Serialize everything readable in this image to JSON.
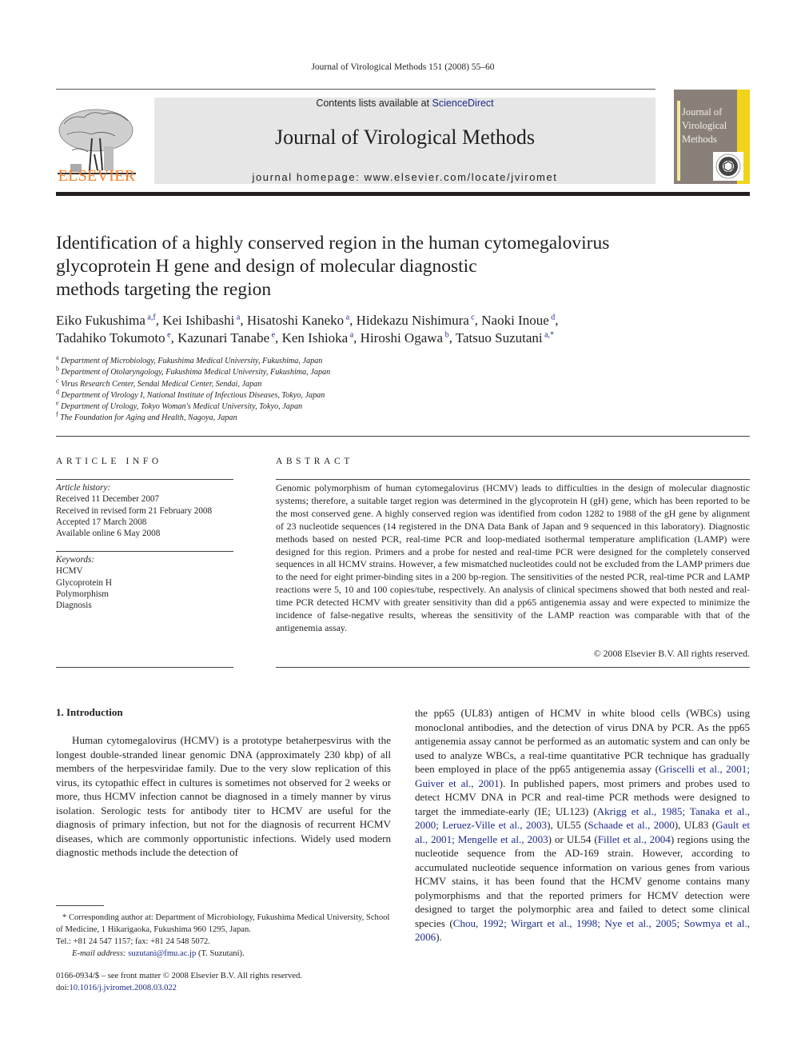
{
  "header": {
    "running_head": "Journal of Virological Methods 151 (2008) 55–60",
    "contents_prefix": "Contents lists available at ",
    "contents_link": "ScienceDirect",
    "journal_title": "Journal of Virological Methods",
    "homepage": "journal homepage: www.elsevier.com/locate/jviromet",
    "publisher_logo_text": "ELSEVIER",
    "cover_title": [
      "Journal of",
      "Virological",
      "Methods"
    ],
    "colors": {
      "elsevier_orange": "#f57b20",
      "link_blue": "#1b2a8a",
      "masthead_gray": "#e6e6e6",
      "cover_yellow": "#f2d31b"
    }
  },
  "article": {
    "title": "Identification of a highly conserved region in the human cytomegalovirus glycoprotein H gene and design of molecular diagnostic methods targeting the region",
    "title_lines": [
      "Identification of a highly conserved region in the human cytomegalovirus",
      "glycoprotein H gene and design of molecular diagnostic",
      "methods targeting the region"
    ],
    "authors": [
      {
        "name": "Eiko Fukushima",
        "aff": "a,f"
      },
      {
        "name": "Kei Ishibashi",
        "aff": "a"
      },
      {
        "name": "Hisatoshi Kaneko",
        "aff": "a"
      },
      {
        "name": "Hidekazu Nishimura",
        "aff": "c"
      },
      {
        "name": "Naoki Inoue",
        "aff": "d"
      },
      {
        "name": "Tadahiko Tokumoto",
        "aff": "e"
      },
      {
        "name": "Kazunari Tanabe",
        "aff": "e"
      },
      {
        "name": "Ken Ishioka",
        "aff": "a"
      },
      {
        "name": "Hiroshi Ogawa",
        "aff": "b"
      },
      {
        "name": "Tatsuo Suzutani",
        "aff": "a,*"
      }
    ],
    "affiliations": [
      {
        "key": "a",
        "text": "Department of Microbiology, Fukushima Medical University, Fukushima, Japan"
      },
      {
        "key": "b",
        "text": "Department of Otolaryngology, Fukushima Medical University, Fukushima, Japan"
      },
      {
        "key": "c",
        "text": "Virus Research Center, Sendai Medical Center, Sendai, Japan"
      },
      {
        "key": "d",
        "text": "Department of Virology I, National Institute of Infectious Diseases, Tokyo, Japan"
      },
      {
        "key": "e",
        "text": "Department of Urology, Tokyo Woman's Medical University, Tokyo, Japan"
      },
      {
        "key": "f",
        "text": "The Foundation for Aging and Health, Nagoya, Japan"
      }
    ]
  },
  "article_info": {
    "label": "ARTICLE INFO",
    "history_label": "Article history:",
    "history": [
      "Received 11 December 2007",
      "Received in revised form 21 February 2008",
      "Accepted 17 March 2008",
      "Available online 6 May 2008"
    ],
    "keywords_label": "Keywords:",
    "keywords": [
      "HCMV",
      "Glycoprotein H",
      "Polymorphism",
      "Diagnosis"
    ]
  },
  "abstract": {
    "label": "ABSTRACT",
    "text": "Genomic polymorphism of human cytomegalovirus (HCMV) leads to difficulties in the design of molecular diagnostic systems; therefore, a suitable target region was determined in the glycoprotein H (gH) gene, which has been reported to be the most conserved gene. A highly conserved region was identified from codon 1282 to 1988 of the gH gene by alignment of 23 nucleotide sequences (14 registered in the DNA Data Bank of Japan and 9 sequenced in this laboratory). Diagnostic methods based on nested PCR, real-time PCR and loop-mediated isothermal temperature amplification (LAMP) were designed for this region. Primers and a probe for nested and real-time PCR were designed for the completely conserved sequences in all HCMV strains. However, a few mismatched nucleotides could not be excluded from the LAMP primers due to the need for eight primer-binding sites in a 200 bp-region. The sensitivities of the nested PCR, real-time PCR and LAMP reactions were 5, 10 and 100 copies/tube, respectively. An analysis of clinical specimens showed that both nested and real-time PCR detected HCMV with greater sensitivity than did a pp65 antigenemia assay and were expected to minimize the incidence of false-negative results, whereas the sensitivity of the LAMP reaction was comparable with that of the antigenemia assay.",
    "copyright": "© 2008 Elsevier B.V. All rights reserved."
  },
  "introduction": {
    "heading": "1.  Introduction",
    "col1": "Human cytomegalovirus (HCMV) is a prototype betaherpesvirus with the longest double-stranded linear genomic DNA (approximately 230 kbp) of all members of the herpesviridae family. Due to the very slow replication of this virus, its cytopathic effect in cultures is sometimes not observed for 2 weeks or more, thus HCMV infection cannot be diagnosed in a timely manner by virus isolation. Serologic tests for antibody titer to HCMV are useful for the diagnosis of primary infection, but not for the diagnosis of recurrent HCMV diseases, which are commonly opportunistic infections. Widely used modern diagnostic methods include the detection of",
    "col2_parts": [
      {
        "t": "the pp65 (UL83) antigen of HCMV in white blood cells (WBCs) using monoclonal antibodies, and the detection of virus DNA by PCR. As the pp65 antigenemia assay cannot be performed as an automatic system and can only be used to analyze WBCs, a real-time quantitative PCR technique has gradually been employed in place of the pp65 antigenemia assay ("
      },
      {
        "link": "Griscelli et al., 2001; Guiver et al., 2001"
      },
      {
        "t": "). In published papers, most primers and probes used to detect HCMV DNA in PCR and real-time PCR methods were designed to target the immediate-early (IE; UL123) ("
      },
      {
        "link": "Akrigg et al., 1985; Tanaka et al., 2000; Leruez-Ville et al., 2003"
      },
      {
        "t": "), UL55 ("
      },
      {
        "link": "Schaade et al., 2000"
      },
      {
        "t": "), UL83 ("
      },
      {
        "link": "Gault et al., 2001; Mengelle et al., 2003"
      },
      {
        "t": ") or UL54 ("
      },
      {
        "link": "Fillet et al., 2004"
      },
      {
        "t": ") regions using the nucleotide sequence from the AD-169 strain. However, according to accumulated nucleotide sequence information on various genes from various HCMV stains, it has been found that the HCMV genome contains many polymorphisms and that the reported primers for HCMV detection were designed to target the polymorphic area and failed to detect some clinical species ("
      },
      {
        "link": "Chou, 1992; Wirgart et al., 1998; Nye et al., 2005; Sowmya et al., 2006"
      },
      {
        "t": ")."
      }
    ]
  },
  "footnote": {
    "star_text": "* Corresponding author at: Department of Microbiology, Fukushima Medical University, School of Medicine, 1 Hikarigaoka, Fukushima 960 1295, Japan.",
    "tel": "Tel.: +81 24 547 1157; fax: +81 24 548 5072.",
    "email_label": "E-mail address: ",
    "email": "suzutani@fmu.ac.jp",
    "email_suffix": " (T. Suzutani).",
    "front_matter": "0166-0934/$ – see front matter © 2008 Elsevier B.V. All rights reserved.",
    "doi_label": "doi:",
    "doi": "10.1016/j.jviromet.2008.03.022"
  }
}
